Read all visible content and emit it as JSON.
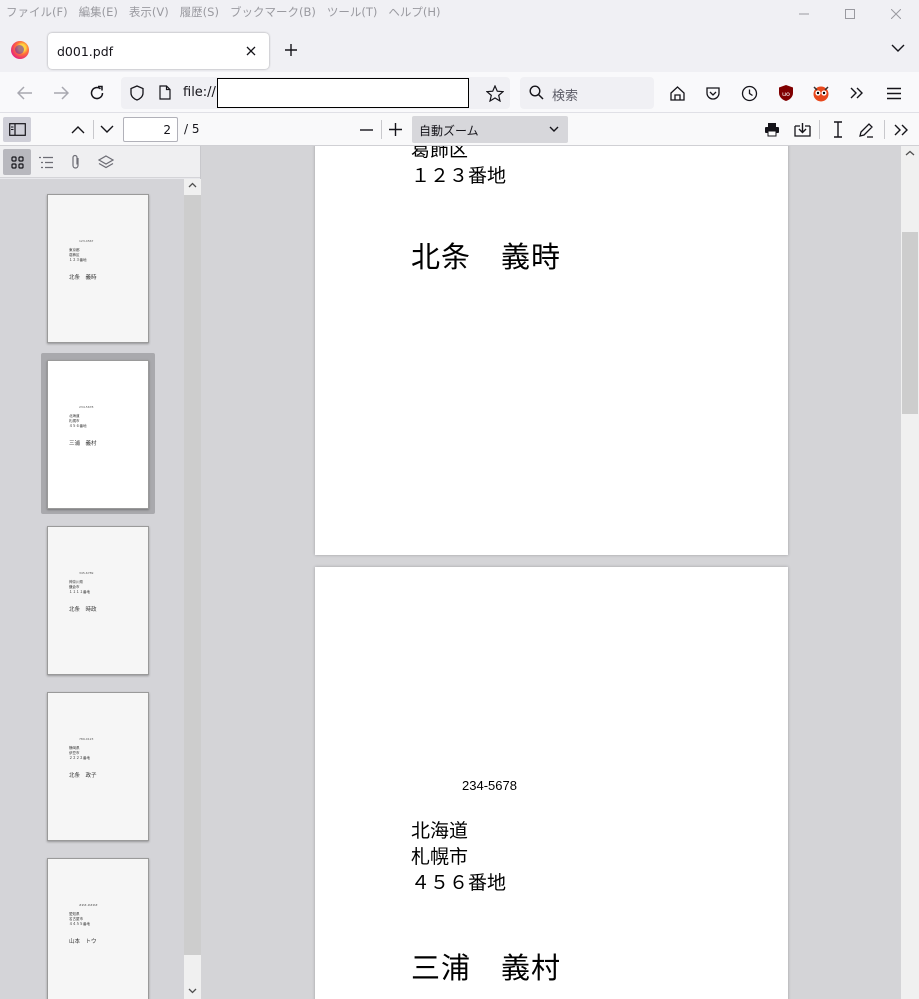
{
  "menubar": {
    "items": [
      "ファイル(F)",
      "編集(E)",
      "表示(V)",
      "履歴(S)",
      "ブックマーク(B)",
      "ツール(T)",
      "ヘルプ(H)"
    ]
  },
  "tab": {
    "title": "d001.pdf"
  },
  "navbar": {
    "url_prefix": "file://",
    "url_value": "",
    "search_placeholder": "検索"
  },
  "pdf_toolbar": {
    "page_number": "2",
    "page_count": "/ 5",
    "zoom": "自動ズーム"
  },
  "thumbnails": [
    {
      "zip": "123-4567",
      "addr": [
        "東京都",
        "葛飾区",
        "１２３番地"
      ],
      "name": "北条　義時"
    },
    {
      "zip": "234-5678",
      "addr": [
        "北海道",
        "札幌市",
        "４５６番地"
      ],
      "name": "三浦　義村"
    },
    {
      "zip": "345-6789",
      "addr": [
        "神奈川県",
        "鎌倉市",
        "１１１１番地"
      ],
      "name": "北条　時政"
    },
    {
      "zip": "789-0123",
      "addr": [
        "静岡県",
        "伊豆市",
        "２２２２番地"
      ],
      "name": "北条　政子"
    },
    {
      "zip": "###-####",
      "addr": [
        "愛知県",
        "名古屋市",
        "４４５５番地"
      ],
      "name": "山本　トウ"
    }
  ],
  "pages": [
    {
      "addr_visible": [
        "葛飾区",
        "１２３番地"
      ],
      "name": "北条　義時"
    },
    {
      "zip": "234-5678",
      "addr": [
        "北海道",
        "札幌市",
        "４５６番地"
      ],
      "name": "三浦　義村"
    }
  ],
  "colors": {
    "sidebar_bg": "#d4d4d8",
    "viewer_bg": "#d4d4d7",
    "toolbar_bg": "#f9f9fa"
  }
}
